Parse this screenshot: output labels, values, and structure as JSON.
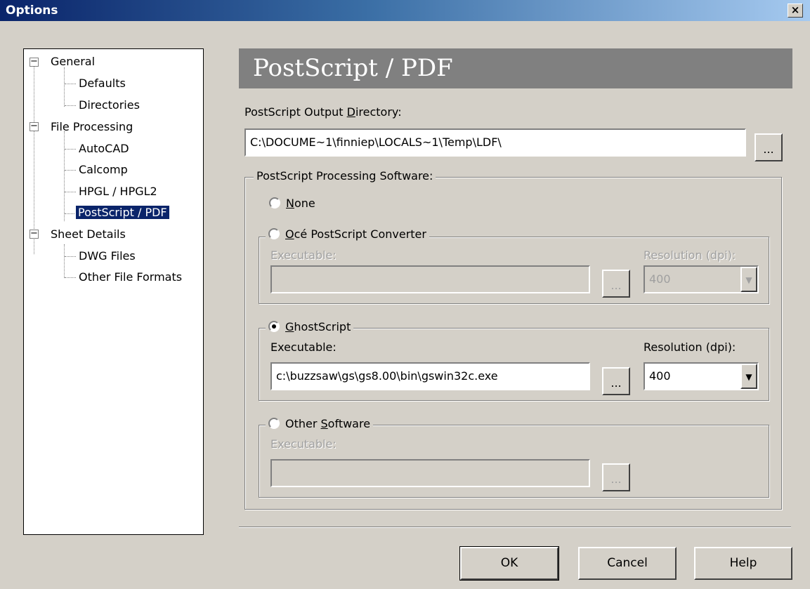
{
  "window": {
    "title": "Options",
    "close_glyph": "×"
  },
  "tree": {
    "items": [
      {
        "label": "General",
        "expander": "−"
      },
      {
        "label": "Defaults"
      },
      {
        "label": "Directories"
      },
      {
        "label": "File Processing",
        "expander": "−"
      },
      {
        "label": "AutoCAD"
      },
      {
        "label": "Calcomp"
      },
      {
        "label": "HPGL / HPGL2"
      },
      {
        "label": "PostScript / PDF",
        "selected": true
      },
      {
        "label": "Sheet Details",
        "expander": "−"
      },
      {
        "label": "DWG Files"
      },
      {
        "label": "Other File Formats"
      }
    ]
  },
  "page": {
    "heading": "PostScript / PDF",
    "output_dir_label_pre": "PostScript Output ",
    "output_dir_label_key": "D",
    "output_dir_label_post": "irectory:",
    "output_dir_value": "C:\\DOCUME~1\\finniep\\LOCALS~1\\Temp\\LDF\\",
    "browse_label": "...",
    "processing_group_label": "PostScript Processing Software:",
    "options": {
      "none": {
        "key": "N",
        "rest": "one",
        "checked": false
      },
      "oce": {
        "key": "O",
        "rest": "cé PostScript Converter",
        "checked": false,
        "exe_label": "Executable:",
        "exe_value": "",
        "res_label": "Resolution (dpi):",
        "res_value": "400"
      },
      "ghost": {
        "key": "G",
        "rest": "hostScript",
        "checked": true,
        "exe_label": "Executable:",
        "exe_value": "c:\\buzzsaw\\gs\\gs8.00\\bin\\gswin32c.exe",
        "res_label": "Resolution (dpi):",
        "res_value": "400"
      },
      "other": {
        "pre": "Other ",
        "key": "S",
        "rest": "oftware",
        "checked": false,
        "exe_label": "Executable:",
        "exe_value": ""
      }
    }
  },
  "buttons": {
    "ok": "OK",
    "cancel": "Cancel",
    "help": "Help"
  },
  "colors": {
    "dialog_bg": "#d4d0c8",
    "titlebar_start": "#0a246a",
    "titlebar_end": "#a6caf0",
    "header_band": "#808080",
    "selection": "#0a246a",
    "disabled_text": "#a0a0a0"
  }
}
